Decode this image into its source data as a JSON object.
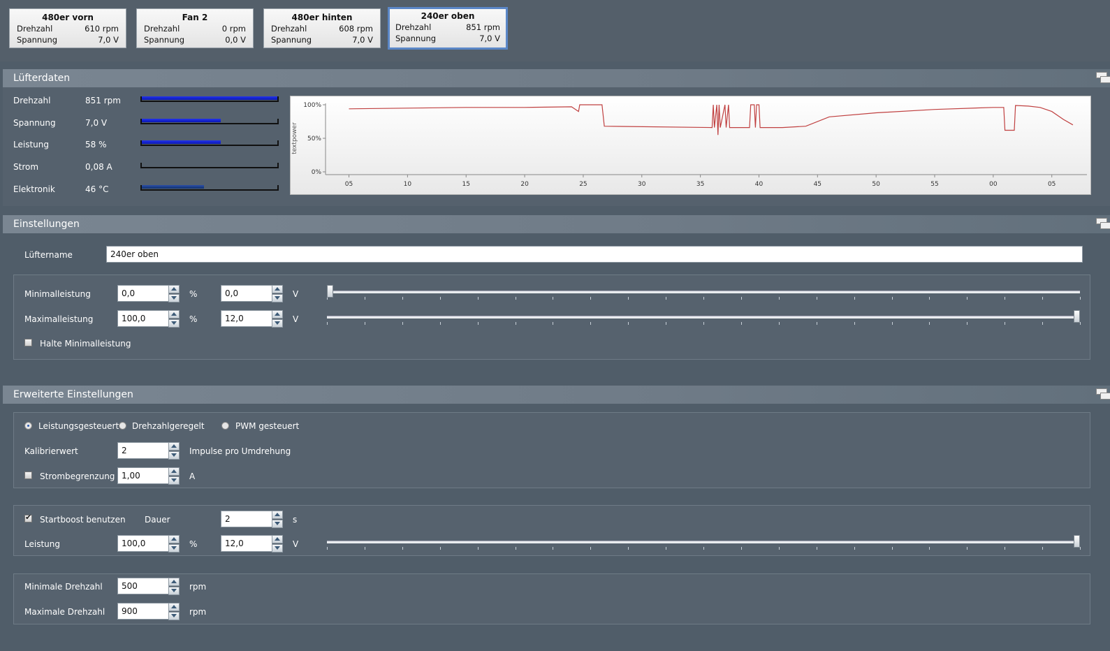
{
  "fans": [
    {
      "title": "480er vorn",
      "speed_label": "Drehzahl",
      "speed": "610 rpm",
      "volt_label": "Spannung",
      "volt": "7,0 V"
    },
    {
      "title": "Fan 2",
      "speed_label": "Drehzahl",
      "speed": "0 rpm",
      "volt_label": "Spannung",
      "volt": "0,0 V"
    },
    {
      "title": "480er hinten",
      "speed_label": "Drehzahl",
      "speed": "608 rpm",
      "volt_label": "Spannung",
      "volt": "7,0 V"
    },
    {
      "title": "240er oben",
      "speed_label": "Drehzahl",
      "speed": "851 rpm",
      "volt_label": "Spannung",
      "volt": "7,0 V",
      "selected": true
    }
  ],
  "fan_data": {
    "title": "Lüfterdaten",
    "rows": [
      {
        "label": "Drehzahl",
        "value": "851 rpm",
        "level": 1.0
      },
      {
        "label": "Spannung",
        "value": "7,0 V",
        "level": 0.58
      },
      {
        "label": "Leistung",
        "value": "58 %",
        "level": 0.58
      },
      {
        "label": "Strom",
        "value": "0,08 A",
        "level": 0.0
      },
      {
        "label": "Elektronik",
        "value": "46 °C",
        "level": 0.46
      }
    ]
  },
  "chart_data": {
    "type": "line",
    "ylabel": "textpower",
    "yticks": [
      "100%",
      "50%",
      "0%"
    ],
    "ylim": [
      0,
      100
    ],
    "xticks": [
      "05",
      "10",
      "15",
      "20",
      "25",
      "30",
      "35",
      "40",
      "45",
      "50",
      "55",
      "00",
      "05"
    ],
    "series": [
      {
        "color": "#c04040",
        "values": [
          {
            "x": 0,
            "y": 94
          },
          {
            "x": 5,
            "y": 95
          },
          {
            "x": 10,
            "y": 96
          },
          {
            "x": 15,
            "y": 96
          },
          {
            "x": 19,
            "y": 97
          },
          {
            "x": 19.6,
            "y": 90
          },
          {
            "x": 19.7,
            "y": 100
          },
          {
            "x": 21.6,
            "y": 100
          },
          {
            "x": 21.8,
            "y": 68
          },
          {
            "x": 31.0,
            "y": 66
          },
          {
            "x": 31.1,
            "y": 100
          },
          {
            "x": 31.2,
            "y": 66
          },
          {
            "x": 31.4,
            "y": 100
          },
          {
            "x": 31.5,
            "y": 55
          },
          {
            "x": 31.6,
            "y": 100
          },
          {
            "x": 31.7,
            "y": 66
          },
          {
            "x": 32.1,
            "y": 100
          },
          {
            "x": 32.2,
            "y": 66
          },
          {
            "x": 32.4,
            "y": 100
          },
          {
            "x": 32.5,
            "y": 66
          },
          {
            "x": 34.2,
            "y": 66
          },
          {
            "x": 34.3,
            "y": 100
          },
          {
            "x": 34.6,
            "y": 100
          },
          {
            "x": 34.7,
            "y": 66
          },
          {
            "x": 34.8,
            "y": 100
          },
          {
            "x": 35.0,
            "y": 100
          },
          {
            "x": 35.1,
            "y": 66
          },
          {
            "x": 37,
            "y": 66
          },
          {
            "x": 39,
            "y": 68
          },
          {
            "x": 41,
            "y": 82
          },
          {
            "x": 45,
            "y": 88
          },
          {
            "x": 50,
            "y": 93
          },
          {
            "x": 55,
            "y": 96
          },
          {
            "x": 55.9,
            "y": 96
          },
          {
            "x": 56.0,
            "y": 62
          },
          {
            "x": 56.8,
            "y": 62
          },
          {
            "x": 56.9,
            "y": 99
          },
          {
            "x": 58,
            "y": 98
          },
          {
            "x": 59,
            "y": 96
          },
          {
            "x": 60,
            "y": 90
          },
          {
            "x": 61,
            "y": 78
          },
          {
            "x": 61.8,
            "y": 70
          }
        ]
      }
    ]
  },
  "settings": {
    "title": "Einstellungen",
    "name_label": "Lüftername",
    "name_value": "240er oben",
    "min_label": "Minimalleistung",
    "min_pct": "0,0",
    "min_volt": "0,0",
    "max_label": "Maximalleistung",
    "max_pct": "100,0",
    "max_volt": "12,0",
    "pct_unit": "%",
    "volt_unit": "V",
    "hold_min_label": "Halte Minimalleistung",
    "min_slider": 0.0,
    "max_slider": 1.0
  },
  "advanced": {
    "title": "Erweiterte Einstellungen",
    "modes": [
      "Leistungsgesteuert",
      "Drehzahlgeregelt",
      "PWM gesteuert"
    ],
    "calib_label": "Kalibrierwert",
    "calib_value": "2",
    "calib_unit": "Impulse pro Umdrehung",
    "current_label": "Strombegrenzung",
    "current_value": "1,00",
    "current_unit": "A",
    "boost_label": "Startboost benutzen",
    "duration_label": "Dauer",
    "duration_value": "2",
    "duration_unit": "s",
    "power_label": "Leistung",
    "power_pct": "100,0",
    "power_volt": "12,0",
    "pct_unit": "%",
    "volt_unit": "V",
    "boost_slider": 1.0,
    "min_rpm_label": "Minimale Drehzahl",
    "min_rpm": "500",
    "max_rpm_label": "Maximale Drehzahl",
    "max_rpm": "900",
    "rpm_unit": "rpm"
  }
}
